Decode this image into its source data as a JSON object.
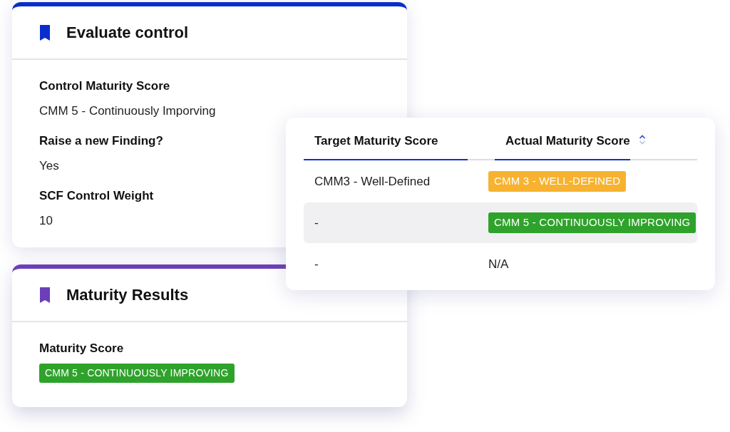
{
  "evaluate_card": {
    "title": "Evaluate control",
    "color": "#0a2ecb",
    "fields": [
      {
        "label": "Control Maturity Score",
        "value": "CMM 5 - Continuously Imporving"
      },
      {
        "label": "Raise a new Finding?",
        "value": "Yes"
      },
      {
        "label": "SCF Control Weight",
        "value": "10"
      }
    ]
  },
  "results_card": {
    "title": "Maturity Results",
    "color": "#6b3fb8",
    "fields": [
      {
        "label": "Maturity Score",
        "value": {
          "kind": "badge",
          "text": "CMM 5 - CONTINUOUSLY IMPROVING",
          "color": "#2fa22c"
        }
      }
    ]
  },
  "table": {
    "columns": [
      {
        "label": "Target Maturity Score",
        "sortable": false
      },
      {
        "label": "Actual Maturity Score",
        "sortable": true
      }
    ],
    "rows": [
      {
        "selected": false,
        "cells": [
          {
            "kind": "text",
            "text": "CMM3 - Well-Defined"
          },
          {
            "kind": "badge",
            "text": "CMM 3 - WELL-DEFINED",
            "color": "#f7b22f"
          }
        ]
      },
      {
        "selected": true,
        "cells": [
          {
            "kind": "text",
            "text": "-"
          },
          {
            "kind": "badge",
            "text": "CMM 5 - CONTINUOUSLY IMPROVING",
            "color": "#2fa22c"
          }
        ]
      },
      {
        "selected": false,
        "cells": [
          {
            "kind": "text",
            "text": "-"
          },
          {
            "kind": "text",
            "text": "N/A"
          }
        ]
      }
    ]
  }
}
